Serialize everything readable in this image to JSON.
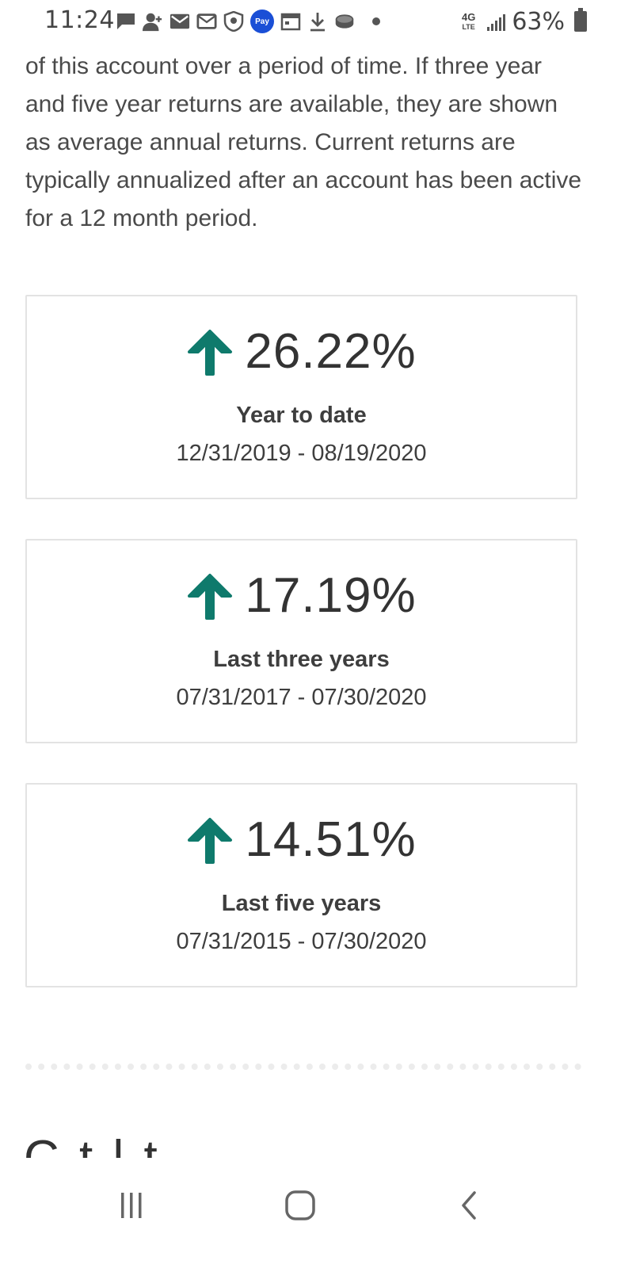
{
  "status_bar": {
    "time": "11:24",
    "pay_label": "Pay",
    "network": "4G",
    "network_sub": "LTE",
    "battery": "63%"
  },
  "intro": {
    "text": "of this account over a period of time. If three year and five year returns are available, they are shown as average annual returns. Current returns are typically annualized after an account has been active for a 12 month period."
  },
  "returns": [
    {
      "value": "26.22%",
      "label": "Year to date",
      "dates": "12/31/2019 - 08/19/2020",
      "direction": "up"
    },
    {
      "value": "17.19%",
      "label": "Last three years",
      "dates": "07/31/2017 - 07/30/2020",
      "direction": "up"
    },
    {
      "value": "14.51%",
      "label": "Last five years",
      "dates": "07/31/2015 - 07/30/2020",
      "direction": "up"
    }
  ],
  "next_section": {
    "heading_partial": "C  t     l  t  "
  },
  "colors": {
    "up_arrow": "#0f7a6c",
    "card_border": "#e3e3e3",
    "text": "#3e3e3e"
  },
  "nav_bar": {
    "recent_icon": "recent-apps-icon",
    "home_icon": "home-icon",
    "back_icon": "back-icon"
  }
}
